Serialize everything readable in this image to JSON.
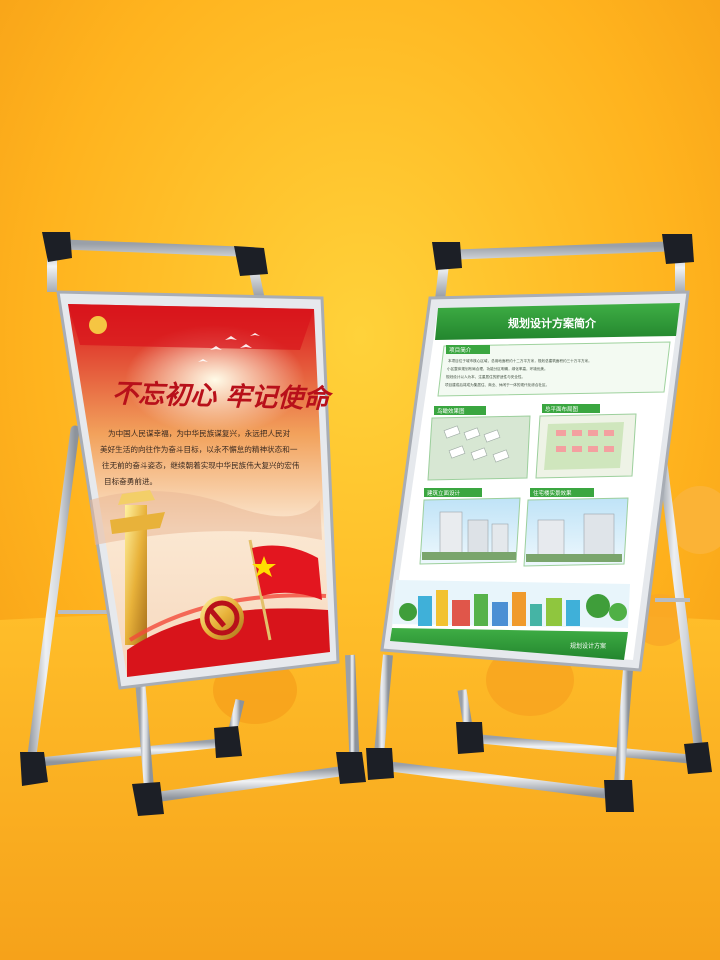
{
  "left_poster": {
    "title": "不忘初心 牢记使命",
    "body_lines": [
      "为中国人民谋幸福，为中华民族谋复兴，永远把人民对",
      "美好生活的向往作为奋斗目标，以永不懈怠的精神状态和一",
      "往无前的奋斗姿态，继续朝着实现中华民族伟大复兴的宏伟",
      "目标奋勇前进。"
    ]
  },
  "right_poster": {
    "title": "规划设计方案简介",
    "intro_label": "项目简介",
    "intro_lines": [
      "本项目位于城市核心区域，总用地面积约十二万平方米，规划总建筑面积约三十万平方米。",
      "小区整体规划布局合理，功能分区明确，绿化率高，环境优美。",
      "规划设计以人为本，注重居住的舒适性与安全性。",
      "项目建成后将成为集居住、商业、休闲于一体的现代化综合社区。"
    ],
    "panels": [
      {
        "label": "鸟瞰效果图"
      },
      {
        "label": "总平面布局图"
      },
      {
        "label": "建筑立面设计"
      },
      {
        "label": "住宅楼实景效果"
      }
    ],
    "footer": "规划设计方案"
  },
  "colors": {
    "background": "#ffb020",
    "stand_frame": "#c8ccd2",
    "corner_cap": "#1c1f26",
    "party_red": "#d8141b",
    "planning_green": "#2f9a3a"
  }
}
